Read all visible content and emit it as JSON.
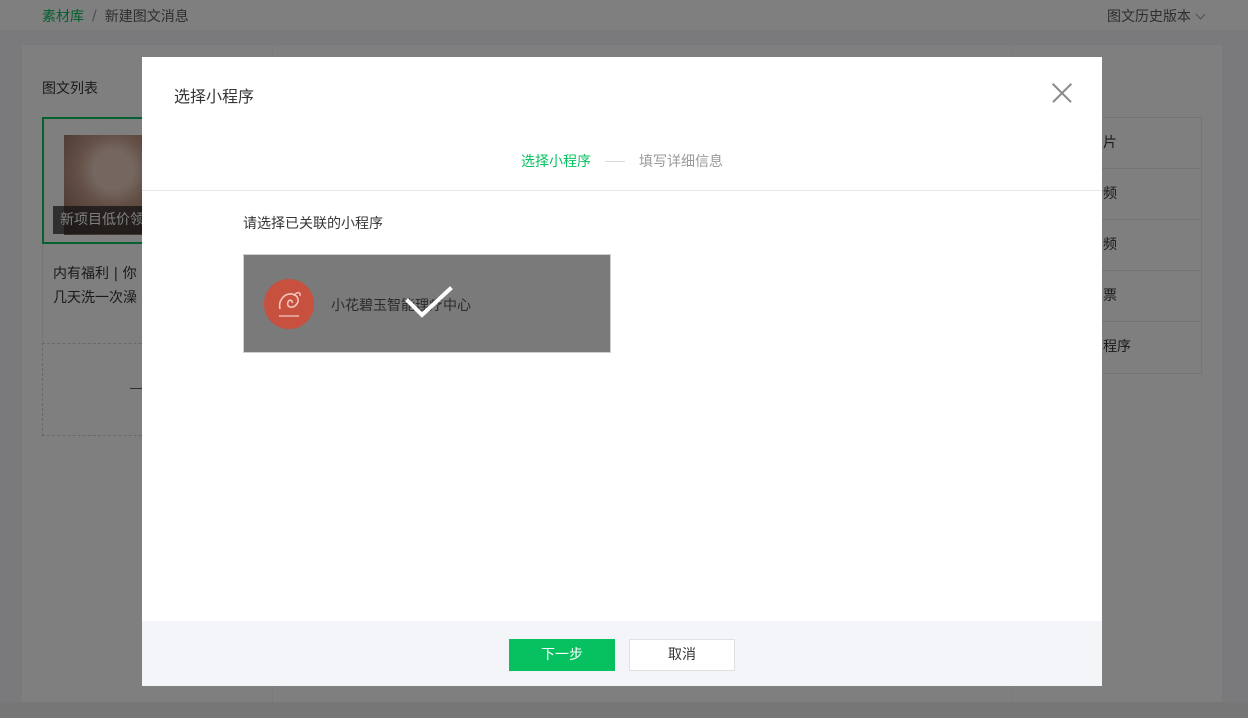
{
  "breadcrumb": {
    "root": "素材库",
    "separator": "/",
    "current": "新建图文消息"
  },
  "header": {
    "history_label": "图文历史版本"
  },
  "left_panel": {
    "title": "图文列表",
    "article_caption": "新项目低价领",
    "sub_line_1": "内有福利 | 你",
    "sub_line_2": "几天洗一次澡",
    "add_symbol": "—"
  },
  "right_panel": {
    "items": [
      {
        "label": "片"
      },
      {
        "label": "频"
      },
      {
        "label": "频"
      },
      {
        "label": "票"
      },
      {
        "label": "程序"
      }
    ]
  },
  "dialog": {
    "title": "选择小程序",
    "steps": [
      {
        "label": "选择小程序"
      },
      {
        "label": "填写详细信息"
      }
    ],
    "prompt": "请选择已关联的小程序",
    "app": {
      "name": "小花碧玉智能理疗中心",
      "selected": true
    },
    "footer": {
      "next_label": "下一步",
      "cancel_label": "取消"
    }
  },
  "colors": {
    "accent": "#07c160",
    "mask": "rgba(0,0,0,0.5)",
    "selected_overlay": "#7a7a7a"
  },
  "icons": [
    "chevron-down-icon",
    "close-icon",
    "check-icon",
    "app-logo"
  ]
}
